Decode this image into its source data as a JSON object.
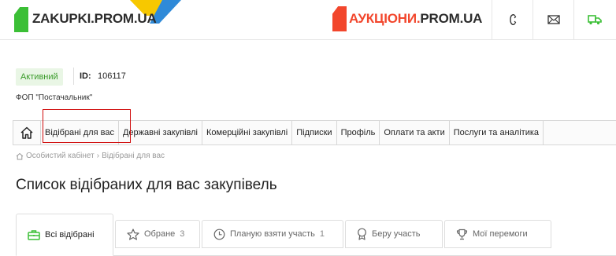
{
  "header": {
    "zakupki_logo": "ZAKUPKI.PROM.UA",
    "auction_logo_part1": "АУКЦІОНИ.",
    "auction_logo_part2": "PROM.UA",
    "accent_green": "#3bbf36",
    "accent_red": "#f2462c",
    "icons": [
      "phone-icon",
      "mail-icon",
      "delivery-truck-icon"
    ]
  },
  "profile": {
    "status": "Активний",
    "id_label": "ID:",
    "id_value": "106117",
    "org_name": "ФОП \"Постачальник\""
  },
  "nav": {
    "home_icon": "home-icon",
    "items": [
      "Відібрані для вас",
      "Державні закупівлі",
      "Комерційні закупівлі",
      "Підписки",
      "Профіль",
      "Оплати та акти",
      "Послуги та аналітика"
    ]
  },
  "breadcrumb": {
    "home": "Особистий кабінет",
    "separator": "›",
    "current": "Відібрані для вас"
  },
  "page_title": "Список відібраних для вас закупівель",
  "tabs": [
    {
      "label": "Всі відібрані",
      "count": "",
      "icon": "briefcase-icon",
      "active": true
    },
    {
      "label": "Обране",
      "count": "3",
      "icon": "star-icon",
      "active": false
    },
    {
      "label": "Планую взяти участь",
      "count": "1",
      "icon": "clock-icon",
      "active": false
    },
    {
      "label": "Беру участь",
      "count": "",
      "icon": "medal-icon",
      "active": false
    },
    {
      "label": "Мої перемоги",
      "count": "",
      "icon": "trophy-icon",
      "active": false
    }
  ]
}
